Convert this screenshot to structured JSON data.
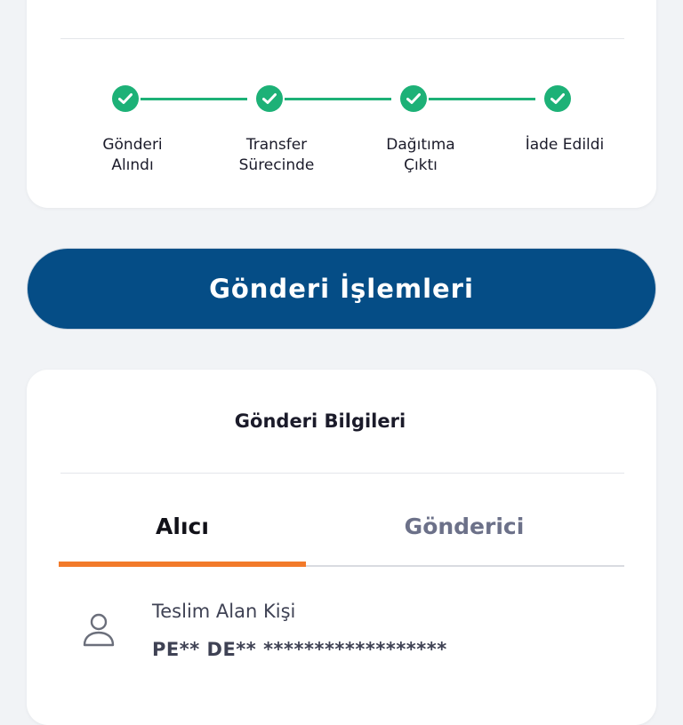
{
  "tracking": {
    "steps": [
      {
        "label": "Gönderi\nAlındı"
      },
      {
        "label": "Transfer\nSürecinde"
      },
      {
        "label": "Dağıtıma\nÇıktı"
      },
      {
        "label": "İade Edildi"
      }
    ],
    "status_color": "#1db177",
    "completed_steps": 4,
    "total_steps": 4
  },
  "actions": {
    "shipment_actions_label": "Gönderi İşlemleri",
    "button_color": "#054d86"
  },
  "shipment_info": {
    "title": "Gönderi Bilgileri",
    "tabs": [
      {
        "label": "Alıcı",
        "active": true
      },
      {
        "label": "Gönderici",
        "active": false
      }
    ],
    "active_tab_color": "#f27a2a",
    "recipient": {
      "icon": "person-icon",
      "field_label": "Teslim Alan Kişi",
      "field_value": "PE** DE** ******************"
    }
  }
}
